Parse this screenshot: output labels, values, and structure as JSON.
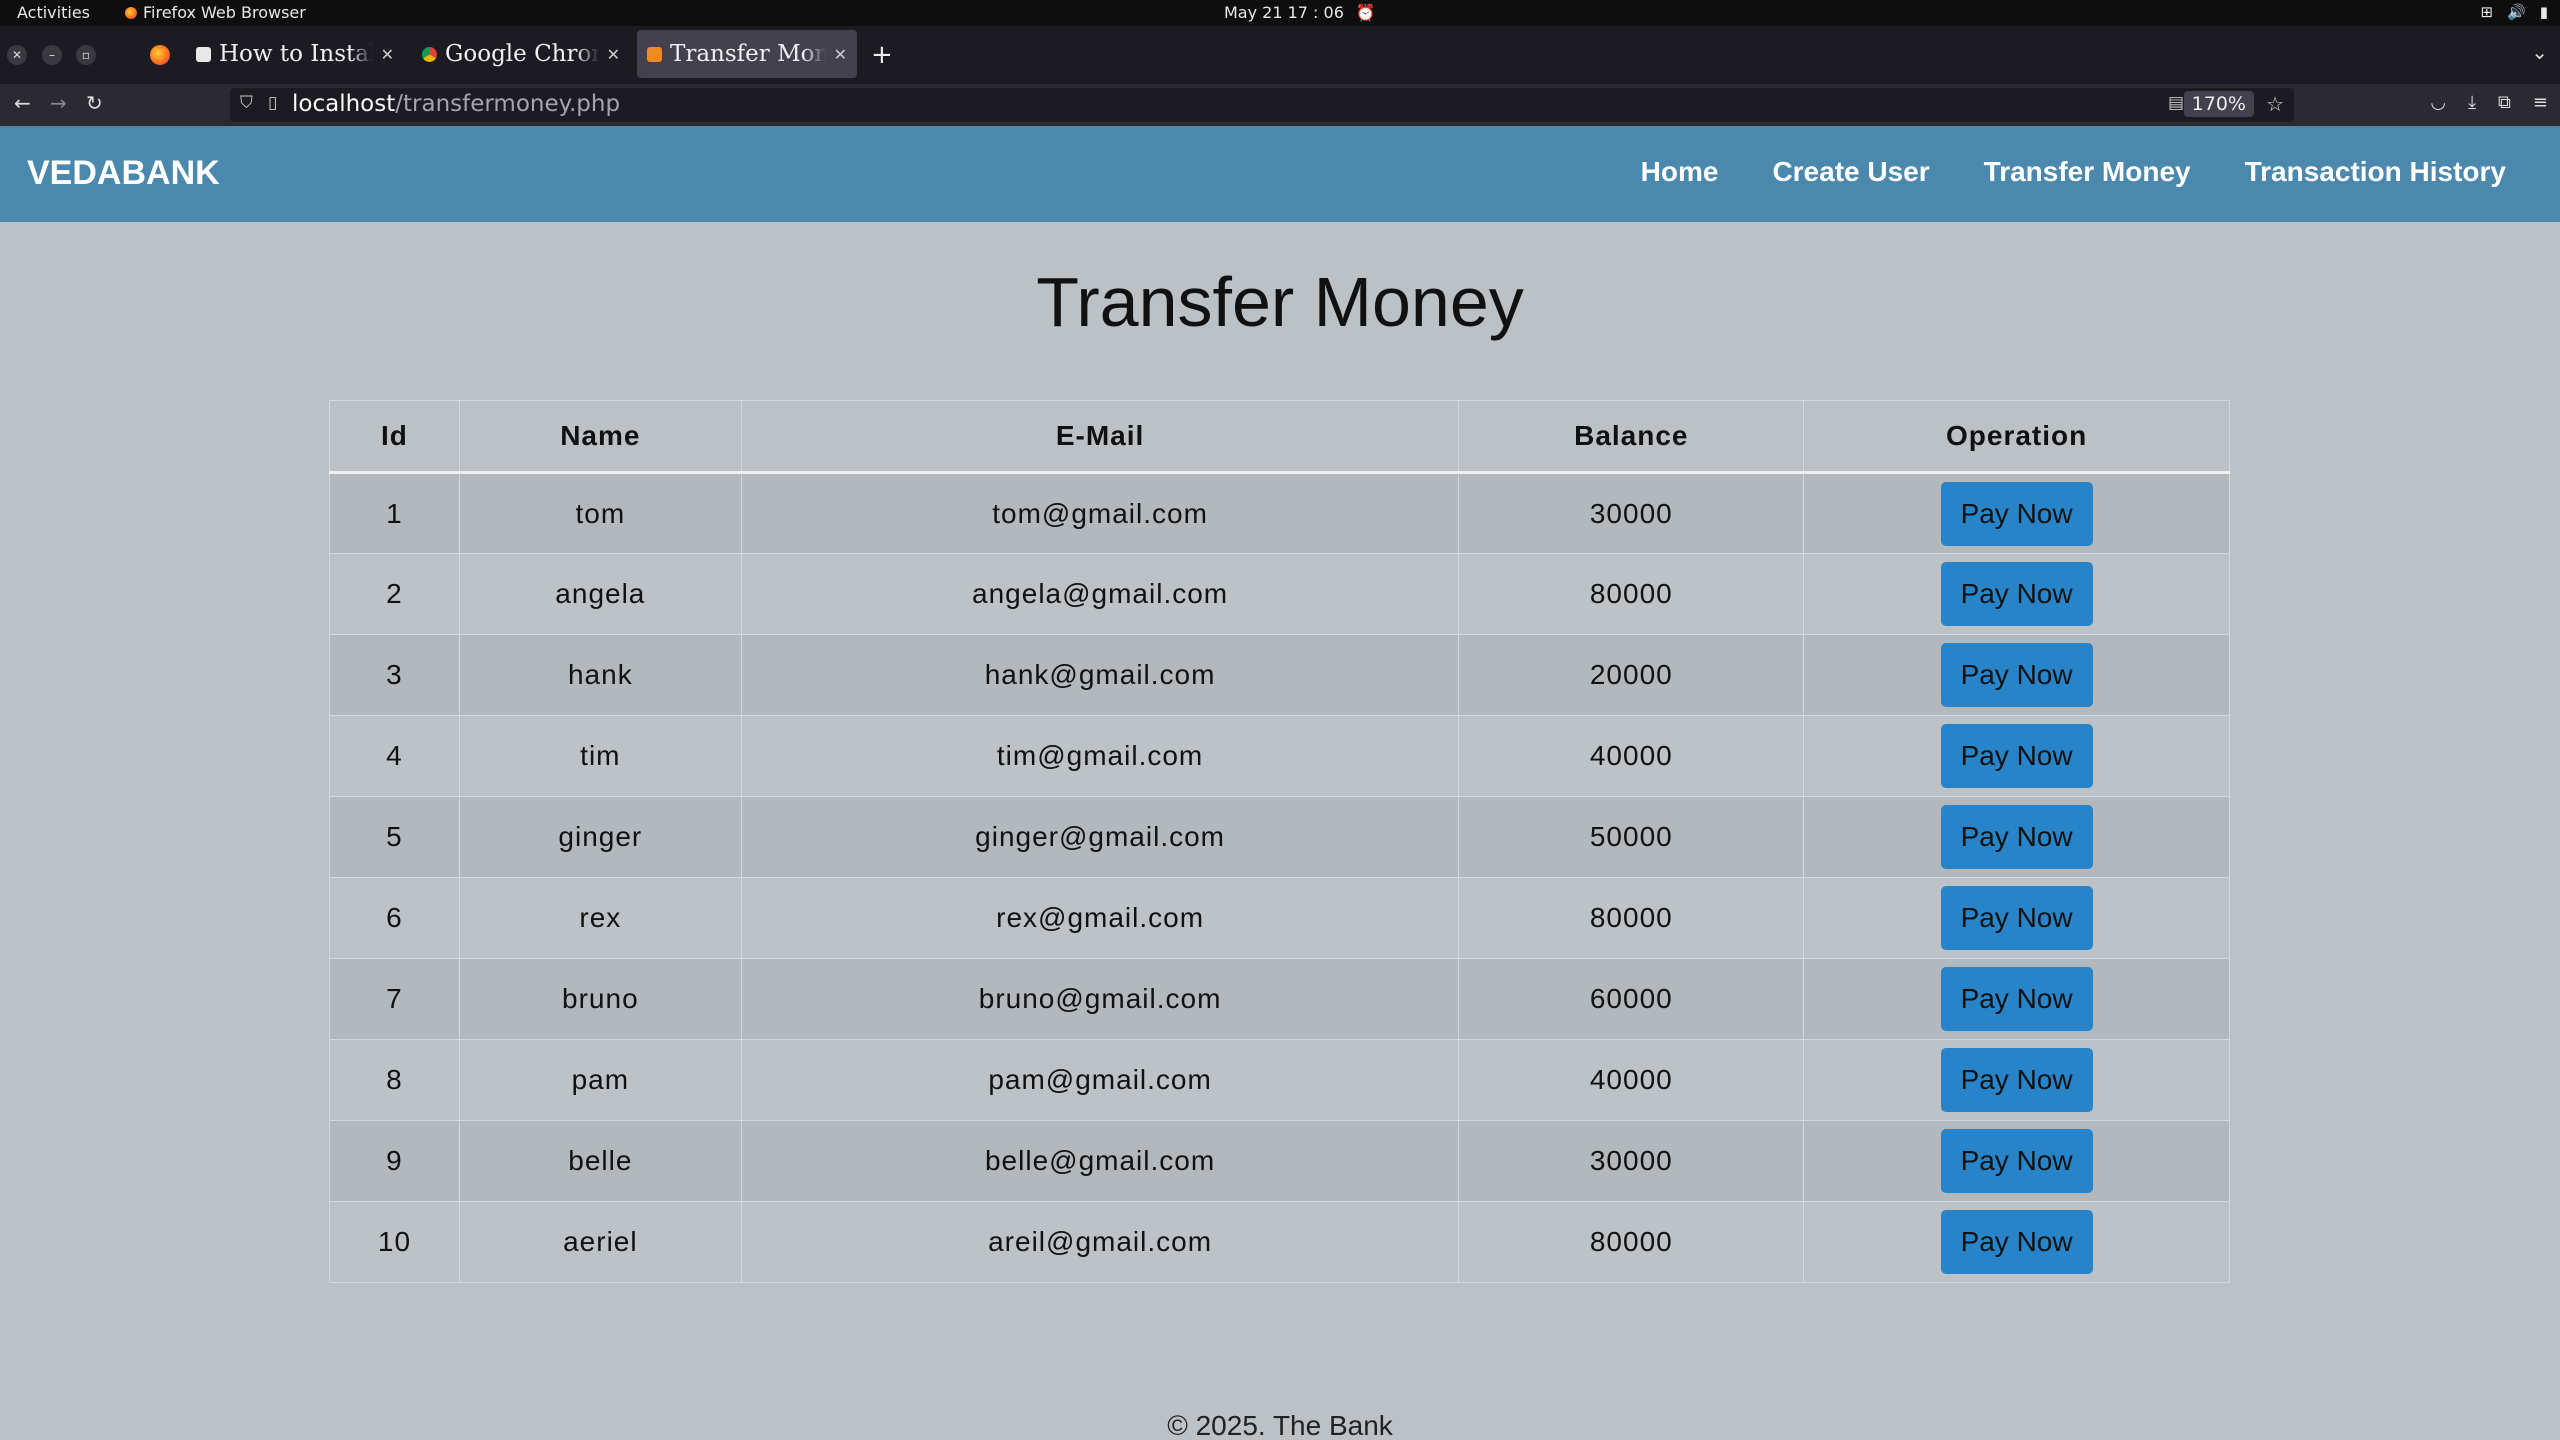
{
  "os": {
    "activities": "Activities",
    "app_name": "Firefox Web Browser",
    "clock": "May 21  17 : 06"
  },
  "browser": {
    "tabs": [
      {
        "title": "How to Install (",
        "favicon": "page-icon"
      },
      {
        "title": "Google Chrome",
        "favicon": "chrome-icon"
      },
      {
        "title": "Transfer Money",
        "favicon": "site-icon",
        "active": true
      }
    ],
    "url_host": "localhost",
    "url_path": "/transfermoney.php",
    "zoom": "170%"
  },
  "site": {
    "brand": "VEDABANK",
    "nav": [
      "Home",
      "Create User",
      "Transfer Money",
      "Transaction History"
    ]
  },
  "page": {
    "title": "Transfer Money",
    "columns": [
      "Id",
      "Name",
      "E-Mail",
      "Balance",
      "Operation"
    ],
    "button_label": "Pay Now",
    "rows": [
      {
        "id": "1",
        "name": "tom",
        "email": "tom@gmail.com",
        "balance": "30000"
      },
      {
        "id": "2",
        "name": "angela",
        "email": "angela@gmail.com",
        "balance": "80000"
      },
      {
        "id": "3",
        "name": "hank",
        "email": "hank@gmail.com",
        "balance": "20000"
      },
      {
        "id": "4",
        "name": "tim",
        "email": "tim@gmail.com",
        "balance": "40000"
      },
      {
        "id": "5",
        "name": "ginger",
        "email": "ginger@gmail.com",
        "balance": "50000"
      },
      {
        "id": "6",
        "name": "rex",
        "email": "rex@gmail.com",
        "balance": "80000"
      },
      {
        "id": "7",
        "name": "bruno",
        "email": "bruno@gmail.com",
        "balance": "60000"
      },
      {
        "id": "8",
        "name": "pam",
        "email": "pam@gmail.com",
        "balance": "40000"
      },
      {
        "id": "9",
        "name": "belle",
        "email": "belle@gmail.com",
        "balance": "30000"
      },
      {
        "id": "10",
        "name": "aeriel",
        "email": "areil@gmail.com",
        "balance": "80000"
      }
    ],
    "footer": "© 2025. The Bank"
  }
}
